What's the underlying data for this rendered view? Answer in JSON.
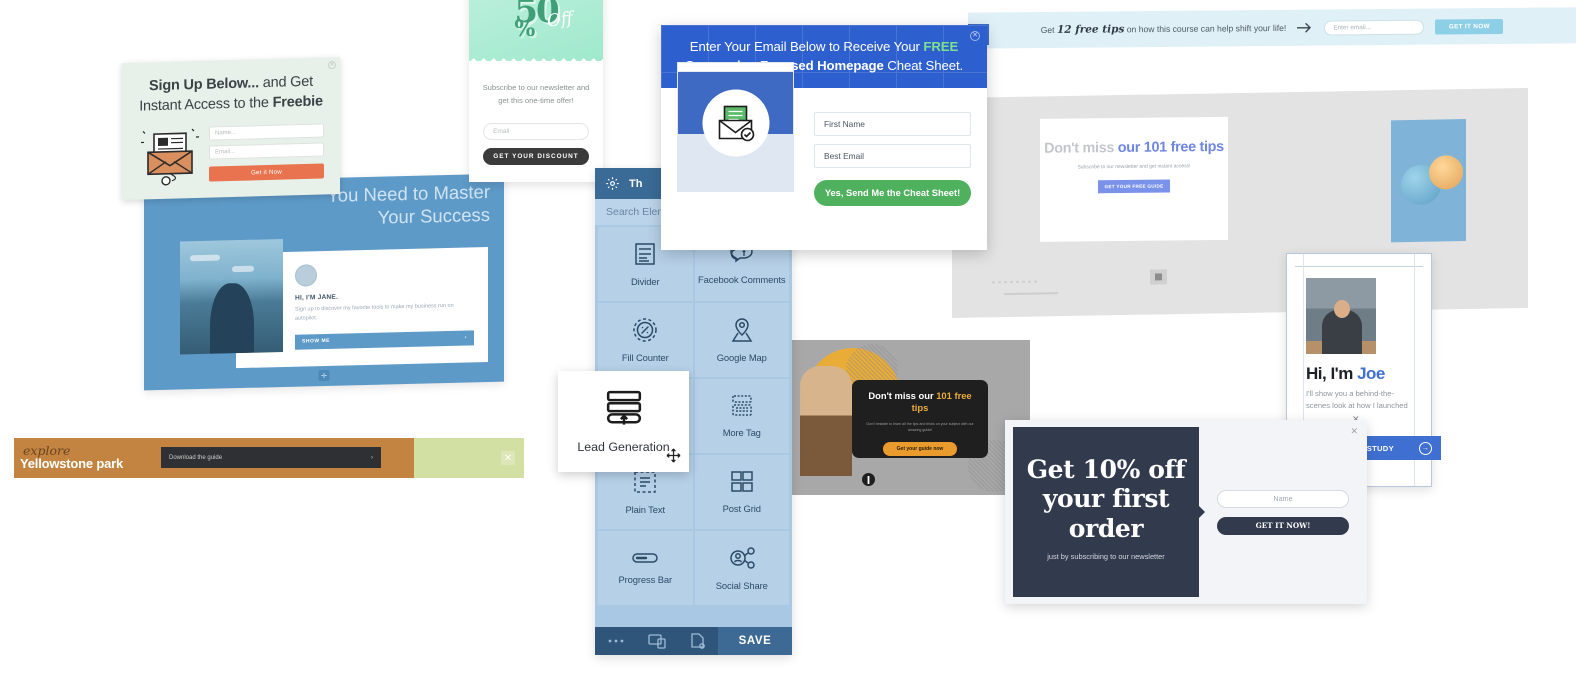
{
  "signup_popup": {
    "title_line1_bold": "Sign Up Below...",
    "title_line1_rest": " and Get",
    "title_line2_rest": "Instant Access to the ",
    "title_line2_bold": "Freebie",
    "name_placeholder": "Name...",
    "email_placeholder": "Email...",
    "button_label": "Get it Now",
    "close_icon": "close-icon",
    "art_icon": "envelope-newsletter-icon",
    "mouse_icon": "mouse-click-icon"
  },
  "discount_popup": {
    "headline_number": "50",
    "headline_percent": "%",
    "headline_off": "Off",
    "subtitle": "Subscribe to our newsletter and get this one-time offer!",
    "email_placeholder": "Email",
    "button_label": "GET YOUR DISCOUNT"
  },
  "widget_panel": {
    "header_title": "Th",
    "header_icon": "gear-icon",
    "search_placeholder": "Search Elements",
    "elements": [
      {
        "label": "Divider",
        "icon": "divider-icon"
      },
      {
        "label": "Facebook Comments",
        "icon": "facebook-comments-icon"
      },
      {
        "label": "Fill Counter",
        "icon": "fill-counter-icon"
      },
      {
        "label": "Google Map",
        "icon": "google-map-icon"
      },
      {
        "label": "Lead Generation",
        "icon": "lead-generation-icon"
      },
      {
        "label": "More Tag",
        "icon": "more-tag-icon"
      },
      {
        "label": "Plain Text",
        "icon": "plain-text-icon"
      },
      {
        "label": "Post Grid",
        "icon": "post-grid-icon"
      },
      {
        "label": "Progress Bar",
        "icon": "progress-bar-icon"
      },
      {
        "label": "Social Share",
        "icon": "social-share-icon"
      }
    ],
    "footer": {
      "more_icon": "ellipsis-icon",
      "responsive_icon": "responsive-preview-icon",
      "page_icon": "page-settings-icon",
      "save_label": "SAVE"
    }
  },
  "lead_card": {
    "label": "Lead Generation",
    "icon": "lead-generation-icon",
    "move_cursor_icon": "move-cursor-icon"
  },
  "cheat_modal": {
    "title_part1": "Enter Your Email Below to Receive Your ",
    "title_free": "FREE",
    "title_part2_bold": "Conversion Focused Homepage",
    "title_part3": " Cheat Sheet.",
    "close_icon": "close-icon",
    "preview_icon": "envelope-check-icon",
    "first_name_placeholder": "First Name",
    "best_email_placeholder": "Best Email",
    "button_label": "Yes, Send Me the Cheat Sheet!"
  },
  "master_panel": {
    "title_line1": "You Need to Master",
    "title_line2": "Your Success",
    "name": "HI, I'M JANE.",
    "body": "Sign up to discover my favorite tools to make my business run on autopilot.",
    "button_label": "SHOW ME",
    "button_arrow": "chevron-right-icon",
    "handle_icon": "drag-handle-icon",
    "avatar_icon": "avatar"
  },
  "yellowstone_bar": {
    "explore": "explore",
    "park": "Yellowstone park",
    "button_label": "Download the guide",
    "button_arrow": "chevron-right-icon",
    "close_icon": "close-icon"
  },
  "topbar": {
    "msg_prefix": "Get ",
    "msg_handwritten": "12 free tips",
    "msg_suffix": " on how this course can help shift your life!",
    "arrow_icon": "arrow-right-icon",
    "email_placeholder": "Enter email...",
    "button_label": "GET IT NOW",
    "close_icon": "close-icon"
  },
  "grey_canvas": {
    "headline_grey": "Don't miss ",
    "headline_blue": "our 101 free tips",
    "subtitle": "Subscribe to our newsletter and get instant access!",
    "button_label": "GET YOUR FREE GUIDE",
    "handle_icon": "drag-handle-icon"
  },
  "dark_canvas": {
    "headline_part1": "Don't miss our ",
    "headline_bold": "101 free tips",
    "subtitle": "Don't hesitate to learn all the tips and tricks on your subject with our amazing guide!",
    "button_label": "Get your guide now",
    "handle_icon": "info-handle-icon"
  },
  "off_modal": {
    "headline_line1": "Get 10% off",
    "headline_line2": "your first order",
    "subtitle": "just by subscribing to our newsletter",
    "name_placeholder": "Name",
    "button_label": "GET IT NOW!",
    "close_icon": "close-icon"
  },
  "joe_card": {
    "headline_part1": "Hi, I'm ",
    "headline_name": "Joe",
    "body": "I'll show you a behind-the-scenes look at how I launched",
    "close_icon": "close-icon",
    "button_label": "CASE STUDY",
    "button_arrow": "arrow-right-circle-icon"
  },
  "colors": {
    "blue_modal": "#2e5fce",
    "green_cta": "#4fb05e",
    "orange_cta": "#e9734e",
    "panel_blue": "#a9c8e3",
    "dark_navy": "#323a4d",
    "yellow": "#e9ad37",
    "brown": "#c28440"
  }
}
